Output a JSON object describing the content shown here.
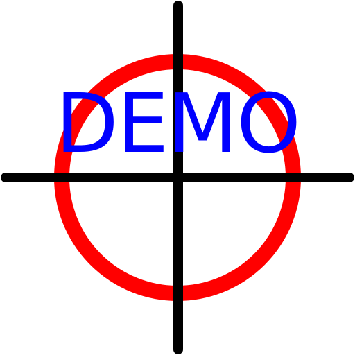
{
  "icon": {
    "name": "crosshair-target-icon",
    "ring_color": "#ff0000",
    "crosshair_color": "#000000",
    "background_color": "#ffffff"
  },
  "watermark": {
    "text": "DEMO",
    "color": "#0000ff"
  }
}
